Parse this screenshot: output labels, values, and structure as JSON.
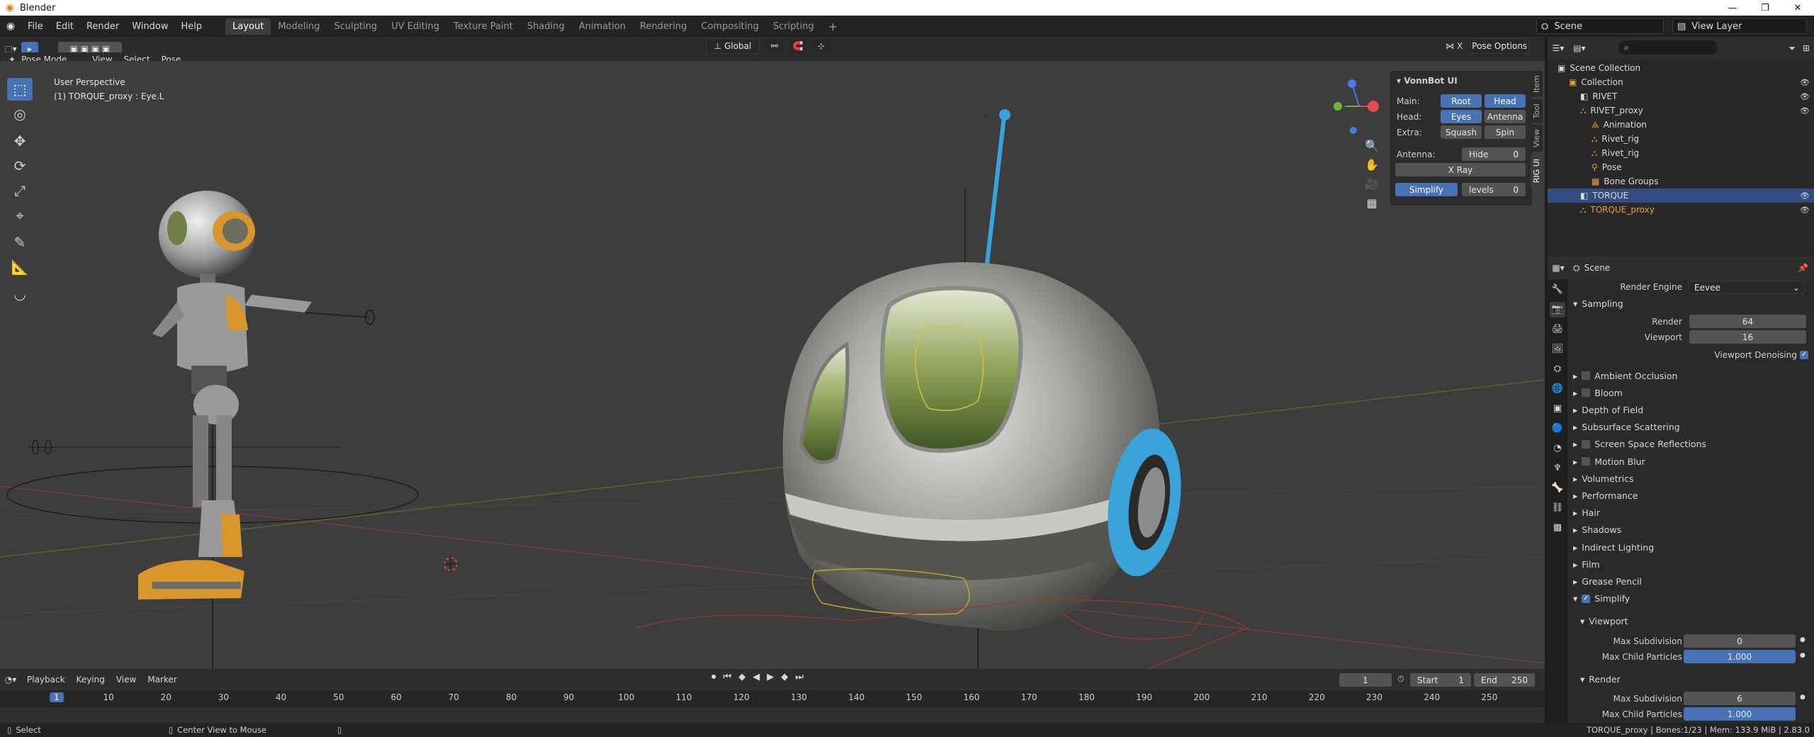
{
  "window": {
    "app_name": "Blender",
    "minimize": "—",
    "maximize": "❐",
    "close": "✕"
  },
  "menu": [
    "File",
    "Edit",
    "Render",
    "Window",
    "Help"
  ],
  "workspaces": [
    "Layout",
    "Modeling",
    "Sculpting",
    "UV Editing",
    "Texture Paint",
    "Shading",
    "Animation",
    "Rendering",
    "Compositing",
    "Scripting"
  ],
  "add_workspace": "+",
  "scene_selector": "Scene",
  "view_layer_selector": "View Layer",
  "viewport_header": {
    "mode": "Pose Mode",
    "menus": [
      "View",
      "Select",
      "Pose"
    ],
    "orientation": "Global",
    "x_label": "X",
    "pose_options": "Pose Options"
  },
  "viewport": {
    "perspective": "User Perspective",
    "active_object": "(1) TORQUE_proxy : Eye.L"
  },
  "tools": [
    "select-box",
    "cursor",
    "move",
    "rotate",
    "scale",
    "transform",
    "annotate",
    "measure",
    "relax"
  ],
  "npanel": {
    "title": "VonnBot UI",
    "main_label": "Main:",
    "main_buttons": [
      "Root",
      "Head"
    ],
    "head_label": "Head:",
    "head_buttons": [
      "Eyes",
      "Antenna"
    ],
    "extra_label": "Extra:",
    "extra_buttons": [
      "Squash",
      "Spin"
    ],
    "antenna_label": "Antenna:",
    "hide_label": "Hide",
    "hide_value": "0",
    "xray": "X Ray",
    "simplify": "Simplify",
    "levels_label": "levels",
    "levels_value": "0",
    "tabs": [
      "Item",
      "Tool",
      "View",
      "RIG UI"
    ]
  },
  "gizmo": {
    "x": "X",
    "y": "Y",
    "z": "Z"
  },
  "outliner": {
    "search_placeholder": "",
    "root": "Scene Collection",
    "items": [
      {
        "label": "Collection",
        "indent": 1
      },
      {
        "label": "RIVET",
        "indent": 2
      },
      {
        "label": "RIVET_proxy",
        "indent": 2
      },
      {
        "label": "Animation",
        "indent": 3
      },
      {
        "label": "Rivet_rig",
        "indent": 3
      },
      {
        "label": "Rivet_rig",
        "indent": 3
      },
      {
        "label": "Pose",
        "indent": 3
      },
      {
        "label": "Bone Groups",
        "indent": 3
      },
      {
        "label": "TORQUE",
        "indent": 2
      },
      {
        "label": "TORQUE_proxy",
        "indent": 2
      }
    ]
  },
  "properties": {
    "context": "Scene",
    "render_engine_label": "Render Engine",
    "render_engine": "Eevee",
    "sampling": "Sampling",
    "render_label": "Render",
    "render_samples": "64",
    "viewport_label": "Viewport",
    "viewport_samples": "16",
    "viewport_denoising": "Viewport Denoising",
    "panels": [
      "Ambient Occlusion",
      "Bloom",
      "Depth of Field",
      "Subsurface Scattering",
      "Screen Space Reflections",
      "Motion Blur",
      "Volumetrics",
      "Performance",
      "Hair",
      "Shadows",
      "Indirect Lighting",
      "Film",
      "Grease Pencil",
      "Simplify"
    ],
    "simplify_viewport": "Viewport",
    "max_subdivision_label": "Max Subdivision",
    "max_child_particles_label": "Max Child Particles",
    "viewport_max_subdivision": "0",
    "viewport_max_child_particles": "1.000",
    "simplify_render": "Render",
    "render_max_subdivision": "6",
    "render_max_child_particles": "1.000"
  },
  "timeline": {
    "menus": [
      "Playback",
      "Keying",
      "View",
      "Marker"
    ],
    "current_frame": "1",
    "start_label": "Start",
    "start": "1",
    "end_label": "End",
    "end": "250",
    "ticks": [
      "1",
      "10",
      "20",
      "30",
      "40",
      "50",
      "60",
      "70",
      "80",
      "90",
      "100",
      "110",
      "120",
      "130",
      "140",
      "150",
      "160",
      "170",
      "180",
      "190",
      "200",
      "210",
      "220",
      "230",
      "240",
      "250"
    ]
  },
  "status": {
    "select": "Select",
    "center_view": "Center View to Mouse",
    "info": "TORQUE_proxy | Bones:1/23 | Mem: 133.9 MiB | 2.83.0"
  },
  "colors": {
    "accent": "#4772b3",
    "orange": "#e8a33d",
    "antenna": "#3aa3d9",
    "viewport_bg": "#3d3d3d"
  }
}
